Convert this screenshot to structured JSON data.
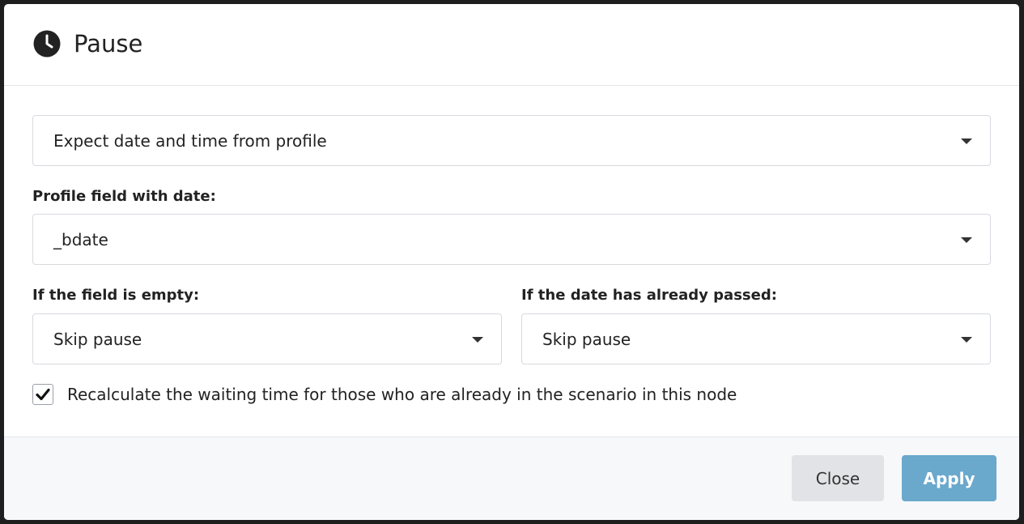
{
  "dialog": {
    "title": "Pause",
    "icon": "clock-icon"
  },
  "mode_select": {
    "value": "Expect date and time from profile"
  },
  "profile_field": {
    "label": "Profile field with date:",
    "value": "_bdate"
  },
  "empty_field": {
    "label": "If the field is empty:",
    "value": "Skip pause"
  },
  "date_passed": {
    "label": "If the date has already passed:",
    "value": "Skip pause"
  },
  "recalculate": {
    "label": "Recalculate the waiting time for those who are already in the scenario in this node",
    "checked": true
  },
  "footer": {
    "close_label": "Close",
    "apply_label": "Apply"
  },
  "colors": {
    "apply_button": "#6aa8cc",
    "close_button": "#e1e3e6",
    "footer_bg": "#f7f8fa",
    "border": "#d6d9de"
  }
}
